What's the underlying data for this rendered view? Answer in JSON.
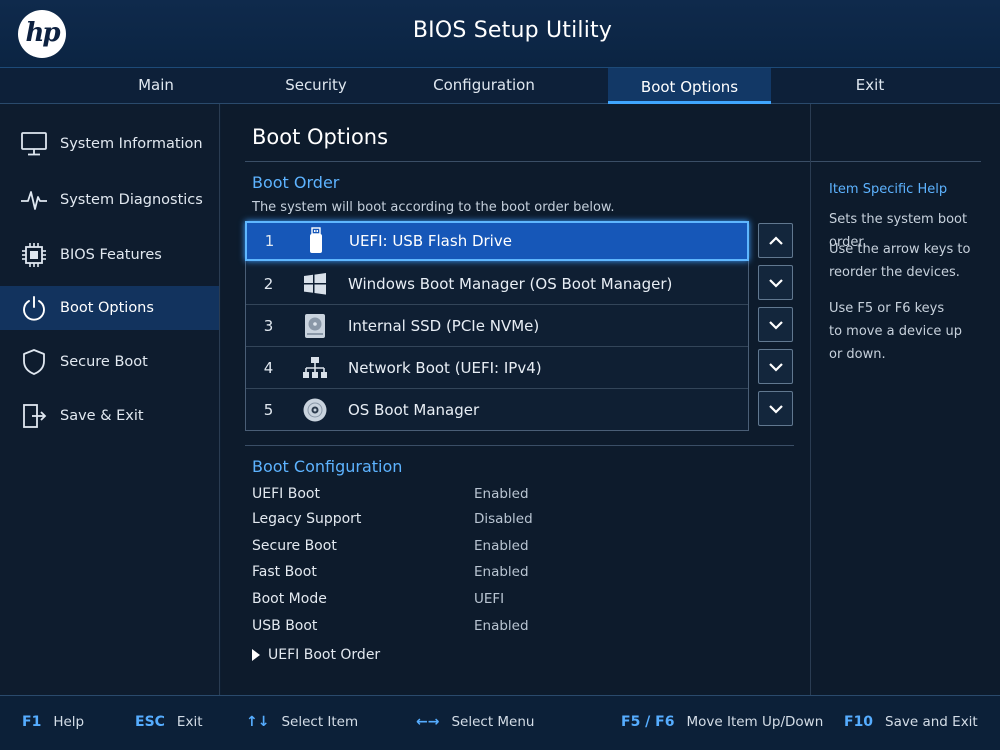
{
  "header": {
    "logo_text": "hp",
    "title": "BIOS Setup Utility"
  },
  "tabs": [
    {
      "label": "Main"
    },
    {
      "label": "Security"
    },
    {
      "label": "Configuration"
    },
    {
      "label": "Boot Options",
      "active": true
    },
    {
      "label": "Exit"
    }
  ],
  "sidebar": {
    "items": [
      {
        "label": "System Information",
        "icon": "monitor-icon"
      },
      {
        "label": "System Diagnostics",
        "icon": "pulse-icon"
      },
      {
        "label": "BIOS Features",
        "icon": "chip-icon"
      },
      {
        "label": "Boot Options",
        "icon": "power-icon",
        "active": true
      },
      {
        "label": "Secure Boot",
        "icon": "shield-icon"
      },
      {
        "label": "Save & Exit",
        "icon": "exit-door-icon"
      }
    ]
  },
  "main": {
    "title": "Boot Options",
    "boot_order": {
      "title": "Boot Order",
      "description": "The system will boot according to the boot order below.",
      "items": [
        {
          "num": "1",
          "label": "UEFI: USB Flash Drive",
          "icon": "usb-drive-icon",
          "selected": true
        },
        {
          "num": "2",
          "label": "Windows Boot Manager (OS Boot Manager)",
          "icon": "windows-icon"
        },
        {
          "num": "3",
          "label": "Internal SSD (PCIe NVMe)",
          "icon": "hard-drive-icon"
        },
        {
          "num": "4",
          "label": "Network Boot (UEFI: IPv4)",
          "icon": "network-icon"
        },
        {
          "num": "5",
          "label": "OS Boot Manager",
          "icon": "disc-icon"
        }
      ]
    },
    "boot_config": {
      "title": "Boot Configuration",
      "rows": [
        {
          "label": "UEFI Boot",
          "value": "Enabled"
        },
        {
          "label": "Legacy Support",
          "value": "Disabled"
        },
        {
          "label": "Secure Boot",
          "value": "Enabled"
        },
        {
          "label": "Fast Boot",
          "value": "Enabled"
        },
        {
          "label": "Boot Mode",
          "value": "UEFI"
        },
        {
          "label": "USB Boot",
          "value": "Enabled"
        }
      ],
      "submenu": "UEFI Boot Order"
    }
  },
  "help": {
    "title": "Item Specific Help",
    "p1": "Sets the system boot order.",
    "p2_line1": "Use the arrow keys to",
    "p2_line2": "reorder the devices.",
    "p3_line1": "Use F5 or F6 keys",
    "p3_line2": "to move a device up",
    "p3_line3": "or down."
  },
  "footer": {
    "keys": [
      {
        "key": "F1",
        "label": "Help"
      },
      {
        "key": "ESC",
        "label": "Exit"
      },
      {
        "key": "↑↓",
        "label": "Select Item"
      },
      {
        "key": "←→",
        "label": "Select Menu"
      },
      {
        "key": "F5 / F6",
        "label": "Move Item Up/Down"
      },
      {
        "key": "F10",
        "label": "Save and Exit"
      }
    ]
  },
  "colors": {
    "accent": "#3fa6ff",
    "selected_row": "#1657b8",
    "section_title": "#5db3ff",
    "background": "#0d1b2c"
  }
}
